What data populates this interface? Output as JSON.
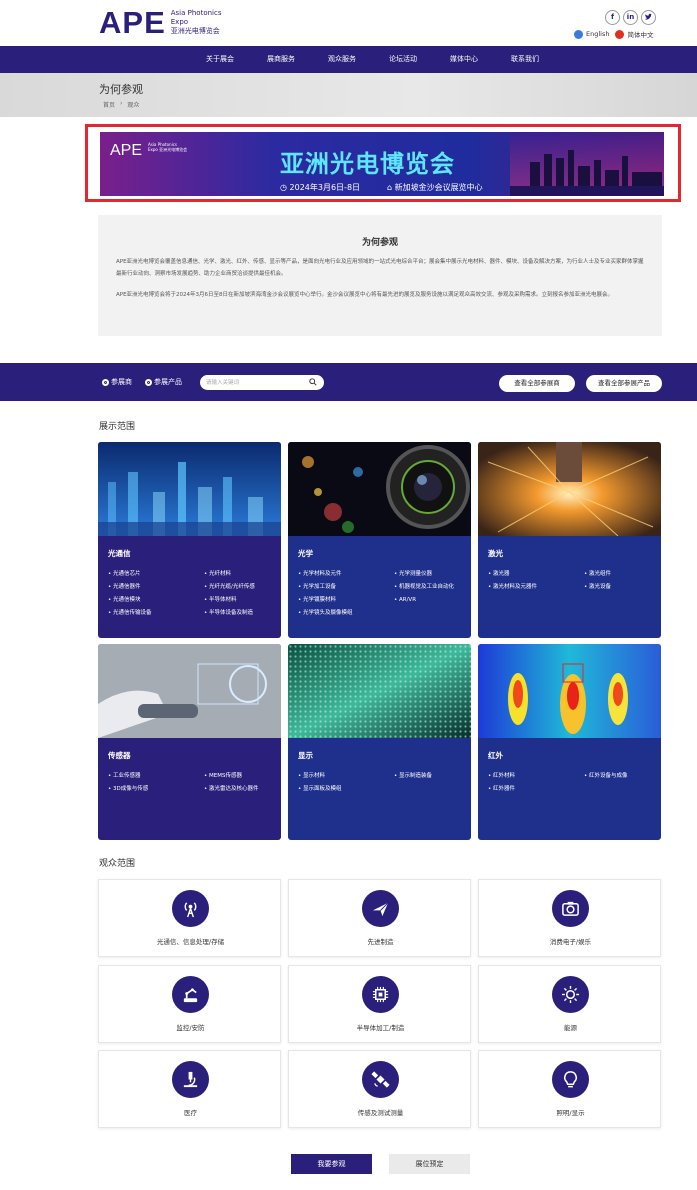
{
  "header": {
    "logo_text": "APE",
    "logo_sub_line1": "Asia Photonics",
    "logo_sub_line2": "Expo",
    "logo_sub_line3": "亚洲光电博览会",
    "socials": [
      "f",
      "in",
      "t"
    ],
    "languages": [
      {
        "label": "English",
        "color": "#3a7bd5"
      },
      {
        "label": "简体中文",
        "color": "#e0301e"
      }
    ]
  },
  "nav": {
    "items": [
      "关于展会",
      "展商服务",
      "观众服务",
      "论坛活动",
      "媒体中心",
      "联系我们"
    ]
  },
  "page": {
    "title": "为何参观",
    "breadcrumb": [
      "首页",
      "›",
      "观众"
    ]
  },
  "banner": {
    "logo": "APE",
    "logo_sub": "Asia Photonics Expo 亚洲光电博览会",
    "title": "亚洲光电博览会",
    "date": "◷ 2024年3月6日-8日",
    "venue": "⌂ 新加坡金沙会议展览中心"
  },
  "why": {
    "heading": "为何参观",
    "p1": "APE亚洲光电博览会覆盖信息通信、光学、激光、红外、传感、显示等产品，是面向光电行业及应用领域的一站式光电综合平台；展会集中展示光电材料、器件、模块、设备及解决方案，为行业人士及专业买家群体掌握最新行业动向、洞察市场发展趋势、助力企业商贸洽谈提供最佳机会。",
    "p2": "APE亚洲光电博览会将于2024年3月6日至8日在新加坡滨海湾金沙会议展览中心举行。金沙会议展览中心将有最先进的展览及服务设施以满足观众高效交流、参观及采购需求。立刻报名参加亚洲光电展会。"
  },
  "search_bar": {
    "radio_exhibitor": "参展商",
    "radio_product": "参展产品",
    "placeholder": "请输入关键词",
    "btn_all_exhibitors": "查看全部参展商",
    "btn_all_products": "查看全部参展产品"
  },
  "exhibit_section": {
    "title": "展示范围",
    "cards": [
      {
        "title": "光通信",
        "items": [
          "光通信芯片",
          "光纤材料",
          "光通信器件",
          "光纤光缆/光纤传感",
          "光通信模块",
          "半导体材料",
          "光通信传输设备",
          "半导体设备及制造"
        ]
      },
      {
        "title": "光学",
        "items": [
          "光学材料及元件",
          "光学测量仪器",
          "光学加工设备",
          "机器视觉及工业自动化",
          "光学镀膜材料",
          "AR/VR",
          "光学镜头及摄像模组"
        ]
      },
      {
        "title": "激光",
        "items": [
          "激光器",
          "激光组件",
          "激光材料及元器件",
          "激光设备"
        ]
      },
      {
        "title": "传感器",
        "items": [
          "工业传感器",
          "MEMS传感器",
          "3D成像与传感",
          "激光雷达及核心器件"
        ]
      },
      {
        "title": "显示",
        "items": [
          "显示材料",
          "显示制造装备",
          "显示面板及模组"
        ]
      },
      {
        "title": "红外",
        "items": [
          "红外材料",
          "红外设备与成像",
          "红外器件"
        ]
      }
    ]
  },
  "audience_section": {
    "title": "观众范围",
    "items": [
      {
        "label": "光通信、信息处理/存储",
        "icon": "antenna-icon"
      },
      {
        "label": "先进制造",
        "icon": "airplane-icon"
      },
      {
        "label": "消费电子/娱乐",
        "icon": "camera-icon"
      },
      {
        "label": "监控/安防",
        "icon": "robot-arm-icon"
      },
      {
        "label": "半导体加工/制造",
        "icon": "chip-icon"
      },
      {
        "label": "能源",
        "icon": "sun-icon"
      },
      {
        "label": "医疗",
        "icon": "microscope-icon"
      },
      {
        "label": "传感及测试测量",
        "icon": "satellite-icon"
      },
      {
        "label": "照明/显示",
        "icon": "bulb-icon"
      }
    ]
  },
  "footer_buttons": {
    "primary": "我要参观",
    "secondary": "展位预定"
  },
  "colors": {
    "brand": "#2a1f7a",
    "highlight_border": "#e3262f",
    "banner_title": "#5ee6ff"
  }
}
